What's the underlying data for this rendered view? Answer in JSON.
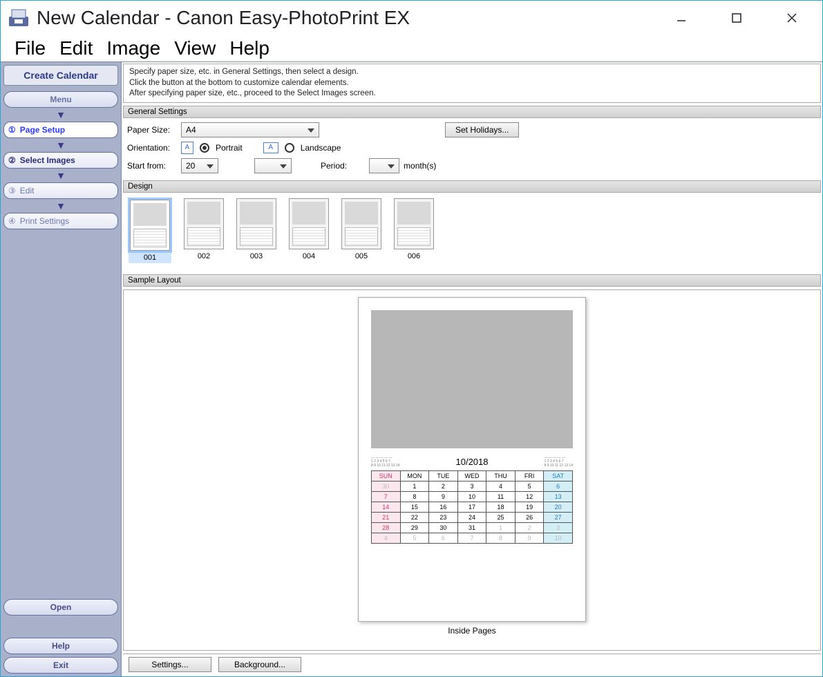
{
  "window": {
    "title": "New Calendar - Canon Easy-PhotoPrint EX"
  },
  "menubar": [
    "File",
    "Edit",
    "Image",
    "View",
    "Help"
  ],
  "sidebar": {
    "app_label": "Create Calendar",
    "menu_btn": "Menu",
    "steps": [
      {
        "num": "①",
        "label": "Page Setup"
      },
      {
        "num": "②",
        "label": "Select Images"
      },
      {
        "num": "③",
        "label": "Edit"
      },
      {
        "num": "④",
        "label": "Print Settings"
      }
    ],
    "open_btn": "Open",
    "help_btn": "Help",
    "exit_btn": "Exit"
  },
  "hint": {
    "l1": "Specify paper size, etc. in General Settings, then select a design.",
    "l2": "Click the button at the bottom to customize calendar elements.",
    "l3": "After specifying paper size, etc., proceed to the Select Images screen."
  },
  "general": {
    "heading": "General Settings",
    "paper_size_label": "Paper Size:",
    "paper_size_value": "A4",
    "set_holidays_btn": "Set Holidays...",
    "orientation_label": "Orientation:",
    "portrait_label": "Portrait",
    "landscape_label": "Landscape",
    "start_from_label": "Start from:",
    "start_year_value": "20",
    "period_label": "Period:",
    "period_unit": "month(s)"
  },
  "design": {
    "heading": "Design",
    "items": [
      "001",
      "002",
      "003",
      "004",
      "005",
      "006"
    ],
    "selected_index": 0
  },
  "sample": {
    "heading": "Sample Layout",
    "month_title": "10/2018",
    "caption": "Inside Pages",
    "weekdays": [
      "SUN",
      "MON",
      "TUE",
      "WED",
      "THU",
      "FRI",
      "SAT"
    ],
    "rows": [
      [
        {
          "d": "30",
          "o": true,
          "sun": true
        },
        {
          "d": "1"
        },
        {
          "d": "2"
        },
        {
          "d": "3"
        },
        {
          "d": "4"
        },
        {
          "d": "5"
        },
        {
          "d": "6",
          "sat": true
        }
      ],
      [
        {
          "d": "7",
          "sun": true
        },
        {
          "d": "8"
        },
        {
          "d": "9"
        },
        {
          "d": "10"
        },
        {
          "d": "11"
        },
        {
          "d": "12"
        },
        {
          "d": "13",
          "sat": true
        }
      ],
      [
        {
          "d": "14",
          "sun": true
        },
        {
          "d": "15"
        },
        {
          "d": "16"
        },
        {
          "d": "17"
        },
        {
          "d": "18"
        },
        {
          "d": "19"
        },
        {
          "d": "20",
          "sat": true
        }
      ],
      [
        {
          "d": "21",
          "sun": true
        },
        {
          "d": "22"
        },
        {
          "d": "23"
        },
        {
          "d": "24"
        },
        {
          "d": "25"
        },
        {
          "d": "26"
        },
        {
          "d": "27",
          "sat": true
        }
      ],
      [
        {
          "d": "28",
          "sun": true
        },
        {
          "d": "29"
        },
        {
          "d": "30"
        },
        {
          "d": "31"
        },
        {
          "d": "1",
          "o": true
        },
        {
          "d": "2",
          "o": true
        },
        {
          "d": "3",
          "o": true,
          "sat": true
        }
      ],
      [
        {
          "d": "4",
          "o": true,
          "sun": true
        },
        {
          "d": "5",
          "o": true
        },
        {
          "d": "6",
          "o": true
        },
        {
          "d": "7",
          "o": true
        },
        {
          "d": "8",
          "o": true
        },
        {
          "d": "9",
          "o": true
        },
        {
          "d": "10",
          "o": true,
          "sat": true
        }
      ]
    ]
  },
  "bottom": {
    "settings_btn": "Settings...",
    "background_btn": "Background..."
  }
}
